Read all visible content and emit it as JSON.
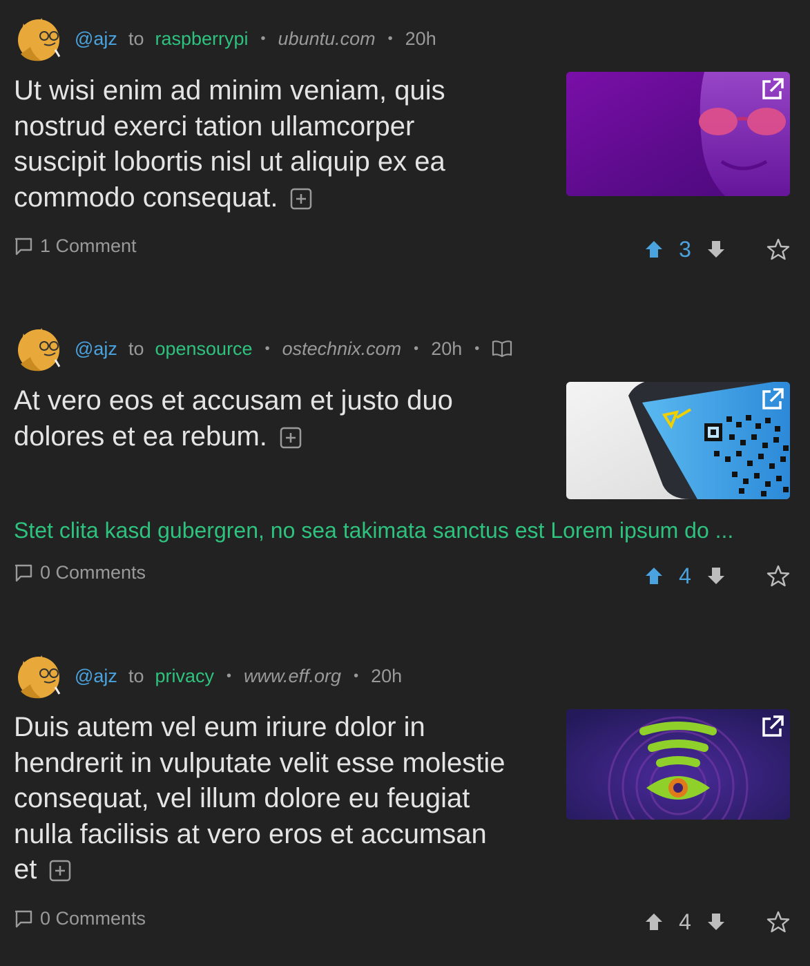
{
  "posts": [
    {
      "user": "@ajz",
      "to": "to",
      "community": "raspberrypi",
      "domain": "ubuntu.com",
      "time": "20h",
      "title": "Ut wisi enim ad minim veniam, quis nostrud exerci tation ullamcorper suscipit lobortis nisl ut aliquip ex ea commodo consequat.",
      "comments": "1 Comment",
      "score": "3",
      "voted": "up",
      "thumbnail": "purple-face-with-red-glasses"
    },
    {
      "user": "@ajz",
      "to": "to",
      "community": "opensource",
      "domain": "ostechnix.com",
      "time": "20h",
      "title": "At vero eos et accusam et justo duo dolores et ea rebum.",
      "body": "Stet clita kasd gubergren, no sea takimata sanctus est Lorem ipsum do ...",
      "comments": "0 Comments",
      "score": "4",
      "voted": "up",
      "thumbnail": "phone-with-qr-code"
    },
    {
      "user": "@ajz",
      "to": "to",
      "community": "privacy",
      "domain": "www.eff.org",
      "time": "20h",
      "title": "Duis autem vel eum iriure dolor in hendrerit in vulputate velit esse molestie consequat, vel illum dolore eu feugiat nulla facilisis at vero eros et accumsan et",
      "comments": "0 Comments",
      "score": "4",
      "voted": "none",
      "thumbnail": "wifi-eye"
    }
  ],
  "colors": {
    "background": "#222222",
    "user": "#4aa3df",
    "community": "#2ec27e",
    "upvoted": "#4aa3df",
    "muted": "#9a9a9a"
  }
}
